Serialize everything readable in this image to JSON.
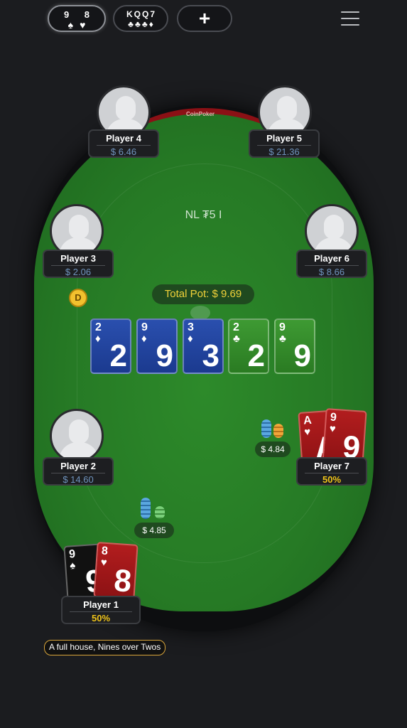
{
  "tabs": [
    {
      "ranks": "9 8",
      "suits": "♠♥"
    },
    {
      "ranks": "KQQ7",
      "suits": "♣♣♣♦"
    },
    {
      "label": "+"
    }
  ],
  "table": {
    "brand": "CoinPoker",
    "game": "NL ₮5 I"
  },
  "players": {
    "p1": {
      "name": "Player 1",
      "stack": "50%"
    },
    "p2": {
      "name": "Player 2",
      "stack": "$ 14.60"
    },
    "p3": {
      "name": "Player 3",
      "stack": "$ 2.06"
    },
    "p4": {
      "name": "Player 4",
      "stack": "$ 6.46"
    },
    "p5": {
      "name": "Player 5",
      "stack": "$ 21.36"
    },
    "p6": {
      "name": "Player 6",
      "stack": "$ 8.66"
    },
    "p7": {
      "name": "Player 7",
      "stack": "50%"
    }
  },
  "dealer": "D",
  "pot": "Total Pot: $ 9.69",
  "board": [
    {
      "rank": "2",
      "suit": "♦"
    },
    {
      "rank": "9",
      "suit": "♦"
    },
    {
      "rank": "3",
      "suit": "♦"
    },
    {
      "rank": "2",
      "suit": "♣"
    },
    {
      "rank": "9",
      "suit": "♣"
    }
  ],
  "hole_p1": [
    {
      "rank": "9",
      "suit": "♠"
    },
    {
      "rank": "8",
      "suit": "♥"
    }
  ],
  "hole_p7": [
    {
      "rank": "A",
      "suit": "♥"
    },
    {
      "rank": "9",
      "suit": "♥"
    }
  ],
  "bets": {
    "p7": "$ 4.84",
    "p2": "$ 4.85"
  },
  "hand_description": "A full house, Nines over Twos",
  "colors": {
    "felt": "#267a25",
    "accent": "#f0c419",
    "stack": "#6f93bd"
  }
}
